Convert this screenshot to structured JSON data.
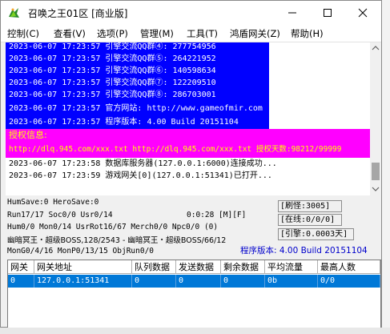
{
  "window": {
    "title": "召唤之王01区 [商业版]"
  },
  "title_buttons": [
    "minimize-button",
    "maximize-button",
    "close-button"
  ],
  "menu": [
    "控制(C)",
    "查看(V)",
    "选项(P)",
    "管理(M)",
    "工具(T)",
    "鸿盾网关(Z)",
    "帮助(H)"
  ],
  "log": {
    "lines": [
      {
        "text": "2023-06-07 17:23:57 引擎交流QQ群④: 277754956",
        "style": "blue"
      },
      {
        "text": "2023-06-07 17:23:57 引擎交流QQ群⑤: 264221952",
        "style": "blue"
      },
      {
        "text": "2023-06-07 17:23:57 引擎交流QQ群⑥: 140598634",
        "style": "blue"
      },
      {
        "text": "2023-06-07 17:23:57 引擎交流QQ群⑦: 122209510",
        "style": "blue"
      },
      {
        "text": "2023-06-07 17:23:57 引擎交流QQ群⑧: 286703001",
        "style": "blue"
      },
      {
        "text": "2023-06-07 17:23:57 官方网站: http://www.gameofmir.com",
        "style": "blue"
      },
      {
        "text": "2023-06-07 17:23:57 程序版本: 4.00 Build 20151104",
        "style": "blue"
      },
      {
        "text": "授权信息:",
        "style": "magenta"
      },
      {
        "text": "http://dlq.945.com/xxx.txt http://dlq.945.com/xxx.txt 授权天数:98212/99999",
        "style": "magenta"
      },
      {
        "text": "2023-06-07 17:23:58 数据库服务器(127.0.0.1:6000)连接成功...",
        "style": "plain"
      },
      {
        "text": "2023-06-07 17:23:59 游戏网关[0](127.0.0.1:51341)已打开...",
        "style": "plain"
      }
    ]
  },
  "status": {
    "line1": "HumSave:0 HeroSave:0",
    "line2": "Run17/17 Soc0/0 Usr0/14",
    "clock": "0:0:28 [M][F]",
    "line3": "Hum0/0 Mon0/14 UsrRot16/67 Merch0/0 Npc0/0 (0)",
    "line4": "幽暗冥王・超级BOSS,128/2543 - 幽暗冥王・超级BOSS/66/12",
    "line5": "MonG0/4/16 MonP0/13/15 ObjRun0/0",
    "refresh": "[刷怪:3005]",
    "online": "[在线:0/0/0]",
    "engine": "[引擎:0.0003天]",
    "version": "程序版本: 4.00 Build 20151104"
  },
  "table": {
    "headers": [
      "网关",
      "网关地址",
      "队列数据",
      "发送数据",
      "剩余数据",
      "平均流量",
      "最高人数"
    ],
    "rows": [
      [
        "0",
        "127.0.0.1:51341",
        "0",
        "0",
        "0",
        "0b",
        "0/0"
      ]
    ]
  },
  "colors": {
    "log_blue": "#0000ff",
    "log_magenta": "#ff00ff",
    "log_text_white": "#ffffff",
    "log_text_yellow": "#ffff00",
    "selection_blue": "#0078d7",
    "version_blue": "#0000cc"
  }
}
